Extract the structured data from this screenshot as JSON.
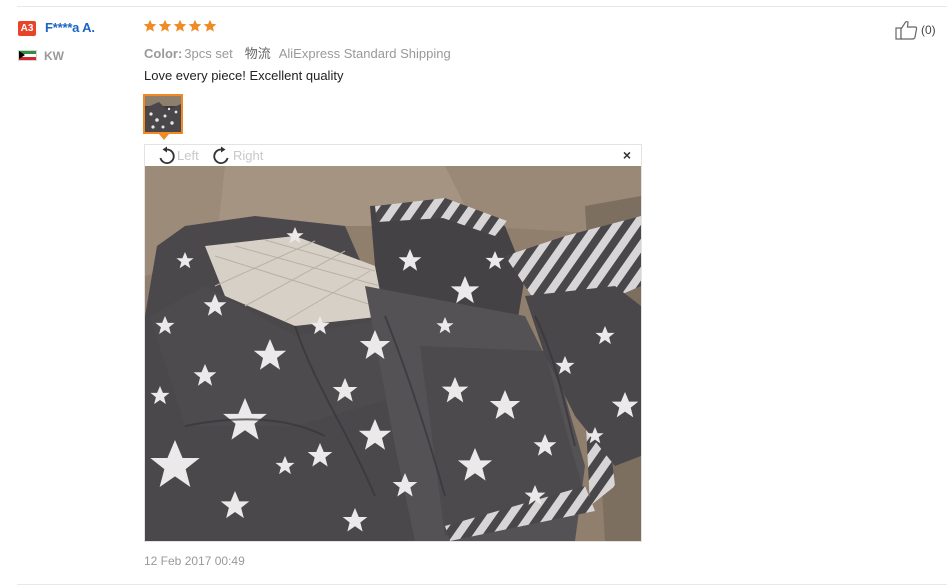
{
  "reviewer": {
    "level_badge": "A3",
    "name": "F****a A.",
    "country_code": "KW",
    "badge_color": "#e8442a",
    "name_color": "#1b63c4"
  },
  "review": {
    "rating": 5,
    "star_color": "#f08a24",
    "color_label": "Color:",
    "color_value": "3pcs set",
    "shipping_label": "物流",
    "shipping_value": "AliExpress Standard Shipping",
    "text": "Love every piece! Excellent quality",
    "date": "12 Feb 2017 00:49"
  },
  "viewer": {
    "rotate_left_label": "Left",
    "rotate_right_label": "Right",
    "close_symbol": "×"
  },
  "helpful": {
    "count_text": "(0)",
    "icon": "thumbs-up-icon"
  }
}
